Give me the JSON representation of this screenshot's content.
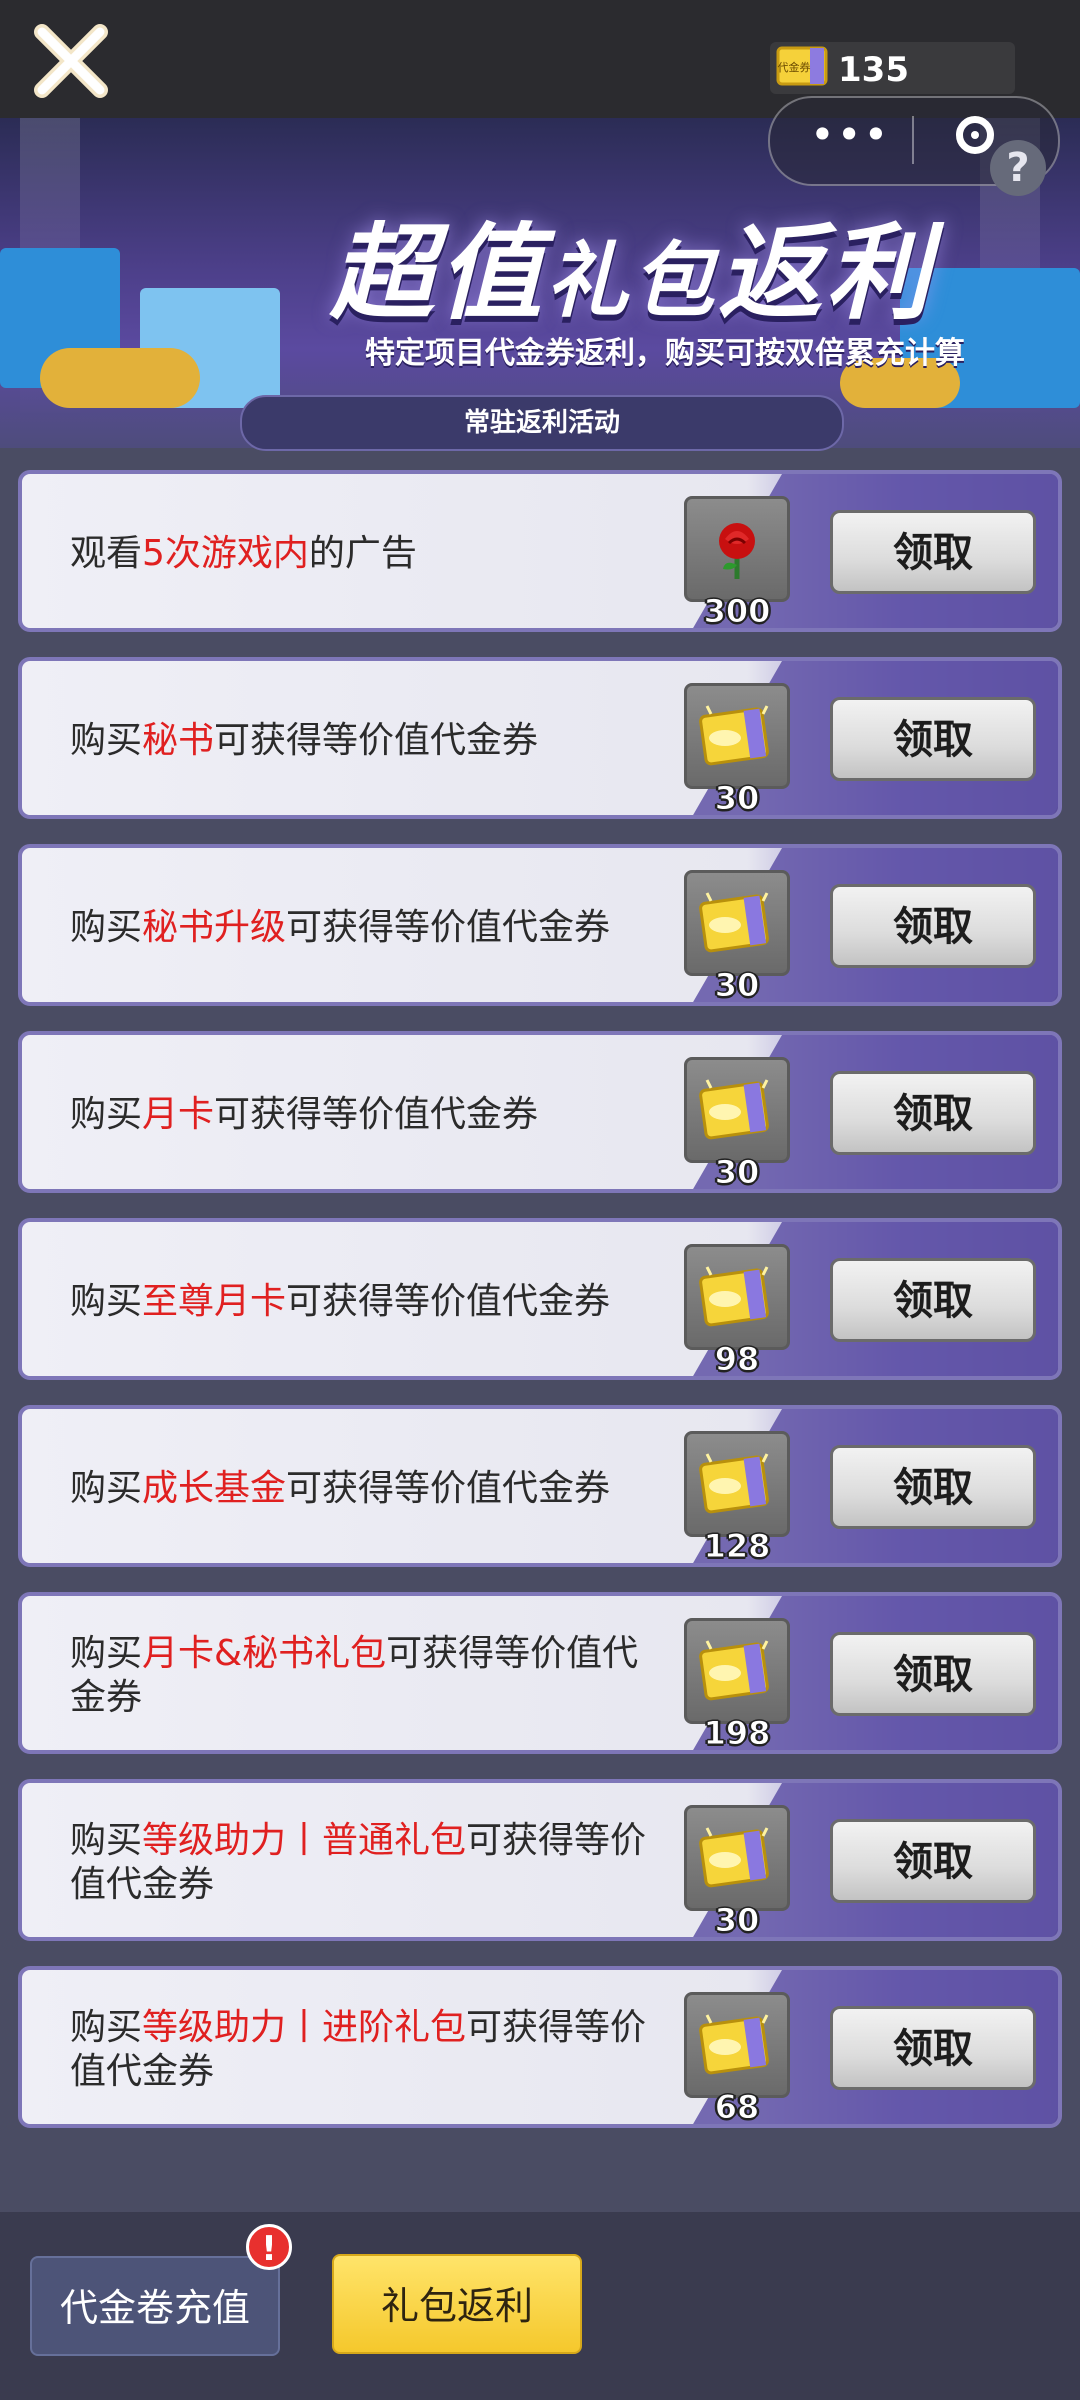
{
  "header": {
    "voucher_count": "135",
    "voucher_icon_label": "代金券"
  },
  "capsule": {
    "more_glyph": "•••",
    "help_glyph": "?"
  },
  "banner": {
    "title_big": "超值",
    "title_small": "礼包",
    "title_big2": "返利",
    "subtitle": "特定项目代金券返利，购买可按双倍累充计算",
    "tab_label": "常驻返利活动"
  },
  "rows": [
    {
      "pre": "观看",
      "highlight": "5次游戏内",
      "post": "的广告",
      "reward_icon": "rose-icon",
      "reward_count": "300",
      "button": "领取"
    },
    {
      "pre": "购买",
      "highlight": "秘书",
      "post": "可获得等价值代金券",
      "reward_icon": "voucher-icon",
      "reward_count": "30",
      "button": "领取"
    },
    {
      "pre": "购买",
      "highlight": "秘书升级",
      "post": "可获得等价值代金券",
      "reward_icon": "voucher-icon",
      "reward_count": "30",
      "button": "领取"
    },
    {
      "pre": "购买",
      "highlight": "月卡",
      "post": "可获得等价值代金券",
      "reward_icon": "voucher-icon",
      "reward_count": "30",
      "button": "领取"
    },
    {
      "pre": "购买",
      "highlight": "至尊月卡",
      "post": "可获得等价值代金券",
      "reward_icon": "voucher-icon",
      "reward_count": "98",
      "button": "领取"
    },
    {
      "pre": "购买",
      "highlight": "成长基金",
      "post": "可获得等价值代金券",
      "reward_icon": "voucher-icon",
      "reward_count": "128",
      "button": "领取"
    },
    {
      "pre": "购买",
      "highlight": "月卡&秘书礼包",
      "post": "可获得等价值代金券",
      "reward_icon": "voucher-icon",
      "reward_count": "198",
      "button": "领取"
    },
    {
      "pre": "购买",
      "highlight": "等级助力丨普通礼包",
      "post": "可获得等价值代金券",
      "reward_icon": "voucher-icon",
      "reward_count": "30",
      "button": "领取"
    },
    {
      "pre": "购买",
      "highlight": "等级助力丨进阶礼包",
      "post": "可获得等价值代金券",
      "reward_icon": "voucher-icon",
      "reward_count": "68",
      "button": "领取"
    }
  ],
  "bottom_nav": {
    "recharge_label": "代金卷充值",
    "gift_label": "礼包返利",
    "alert_glyph": "!"
  },
  "colors": {
    "highlight_text": "#e02020",
    "accent_purple": "#5f52a6",
    "gift_tab_yellow": "#f5c82c"
  }
}
